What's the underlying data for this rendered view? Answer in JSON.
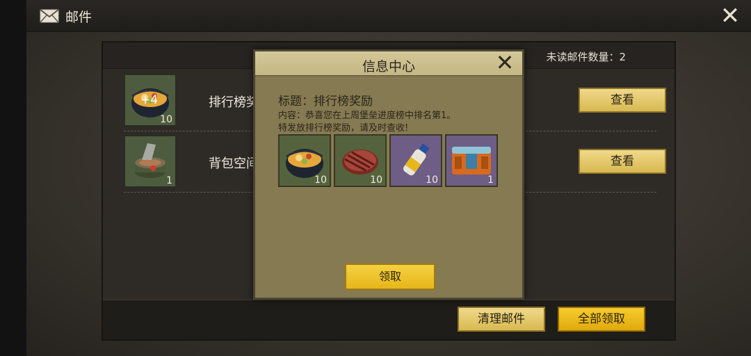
{
  "topbar": {
    "title": "邮件",
    "mail_icon": "envelope-icon",
    "close_icon": "close-x-icon"
  },
  "panel": {
    "unread_label": "未读邮件数量：2",
    "mails": [
      {
        "subject": "排行榜奖",
        "icon": "stew-pot-icon",
        "badge": "+4",
        "count": "10",
        "view_label": "查看"
      },
      {
        "subject": "背包空间",
        "icon": "open-can-icon",
        "count": "1",
        "view_label": "查看"
      }
    ],
    "clear_label": "清理邮件",
    "claim_all_label": "全部领取"
  },
  "modal": {
    "title": "信息中心",
    "subject": "标题：排行榜奖励",
    "body_line1": "内容：恭喜您在上周堡垒进度榜中排名第1。",
    "body_line2": "特发放排行榜奖励，请及时查收!",
    "rewards": [
      {
        "icon": "stew-pot-icon",
        "count": "10",
        "rarity": "green"
      },
      {
        "icon": "steak-icon",
        "count": "10",
        "rarity": "green"
      },
      {
        "icon": "bottle-icon",
        "count": "10",
        "rarity": "purple"
      },
      {
        "icon": "supply-crate-icon",
        "count": "1",
        "rarity": "purple"
      }
    ],
    "claim_label": "领取"
  },
  "colors": {
    "gold_button": "#e7b61a",
    "accent_gold": "#d8b951",
    "modal_bg": "#857a51"
  }
}
